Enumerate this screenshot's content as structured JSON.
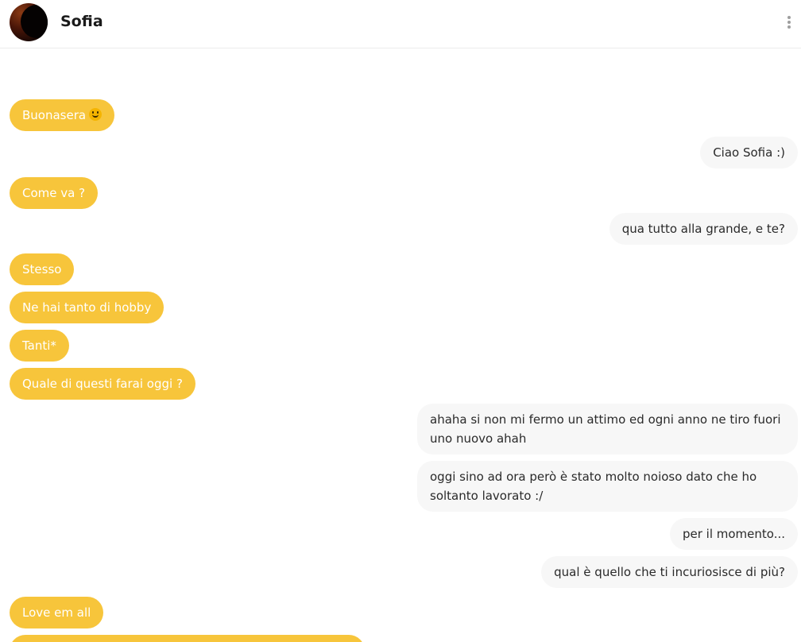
{
  "header": {
    "contact_name": "Sofia"
  },
  "icons": {
    "avatar": "avatar-photo",
    "menu": "kebab-menu-icon",
    "emoji": "smiling-face-emoji"
  },
  "colors": {
    "incoming_bubble": "#f7c53b",
    "outgoing_bubble": "#f7f7f7"
  },
  "messages": [
    {
      "side": "in",
      "text": "Buonasera",
      "emoji": "smiling-face-emoji"
    },
    {
      "side": "out",
      "text": "Ciao Sofia :)"
    },
    {
      "side": "in",
      "text": "Come va ?"
    },
    {
      "side": "out",
      "text": "qua tutto alla grande, e te?"
    },
    {
      "side": "in",
      "text": "Stesso"
    },
    {
      "side": "in",
      "text": "Ne hai tanto di hobby"
    },
    {
      "side": "in",
      "text": "Tanti*"
    },
    {
      "side": "in",
      "text": "Quale di questi farai oggi ?"
    },
    {
      "side": "out",
      "text": "ahaha si non mi fermo un attimo ed ogni anno ne tiro fuori uno nuovo ahah"
    },
    {
      "side": "out",
      "text": "oggi sino ad ora però è stato molto noioso dato che ho soltanto lavorato :/"
    },
    {
      "side": "out",
      "text": "per il momento..."
    },
    {
      "side": "out",
      "text": "qual è quello che ti incuriosisce di più?"
    },
    {
      "side": "in",
      "text": "Love em all"
    }
  ]
}
